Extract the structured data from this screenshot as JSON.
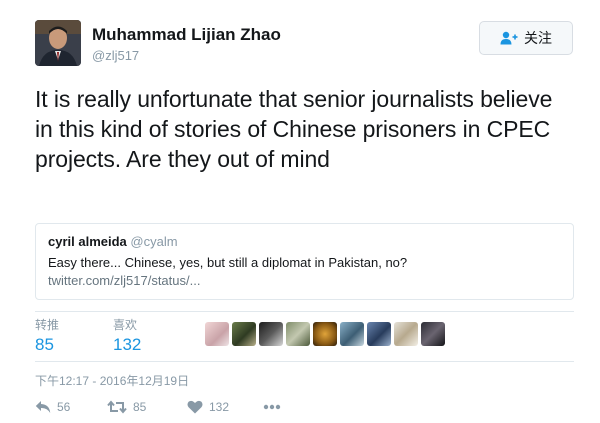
{
  "author": {
    "name": "Muhammad Lijian Zhao",
    "handle": "@zlj517"
  },
  "follow_button": {
    "label": "关注"
  },
  "tweet": {
    "text": "It is really unfortunate that senior journalists believe in this kind of stories of Chinese prisoners in CPEC projects. Are they out of mind"
  },
  "quoted_tweet": {
    "name": "cyril almeida",
    "handle": "@cyalm",
    "text": "Easy there... Chinese, yes, but still a diplomat in Pakistan, no?",
    "link": "twitter.com/zlj517/status/..."
  },
  "stats": {
    "retweets_label": "转推",
    "retweets_value": "85",
    "likes_label": "喜欢",
    "likes_value": "132"
  },
  "likers_count": 9,
  "timestamp": "下午12:17 - 2016年12月19日",
  "actions": {
    "reply_count": "56",
    "retweet_count": "85",
    "like_count": "132"
  },
  "colors": {
    "accent": "#1b95e0",
    "muted": "#8899a6",
    "border": "#e1e8ed"
  }
}
